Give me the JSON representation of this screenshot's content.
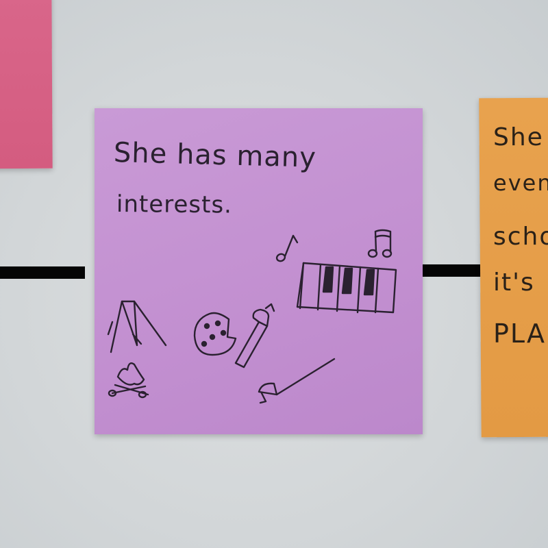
{
  "photo": {
    "colors": {
      "background": "#d4d8da",
      "note_pink": "#d6607f",
      "note_purple": "#c592d2",
      "note_orange": "#e6a04a",
      "line": "#050505",
      "ink": "#2a2130"
    }
  },
  "purple_note": {
    "line1": "She has many",
    "line2": "interests.",
    "doodle_icons": [
      "music-note-icon",
      "double-music-note-icon",
      "piano-keys-icon",
      "tent-icon",
      "campfire-icon",
      "cookie-icon",
      "marshmallow-stick-icon",
      "fencing-sword-icon"
    ]
  },
  "orange_note": {
    "lines": [
      "She",
      "even",
      "scho",
      "it's",
      "PLA"
    ]
  }
}
